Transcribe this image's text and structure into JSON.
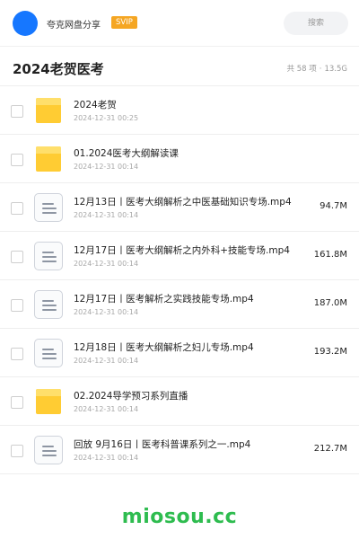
{
  "topbar": {
    "username": "夸克网盘分享",
    "badge": "SVIP",
    "search_placeholder": "搜索"
  },
  "header": {
    "title": "2024老贺医考",
    "item_count": "共 58 项",
    "total_size": "13.5G"
  },
  "files": [
    {
      "type": "folder",
      "name": "2024老贺",
      "date": "2024-12-31 00:25",
      "size": ""
    },
    {
      "type": "folder",
      "name": "01.2024医考大纲解读课",
      "date": "2024-12-31 00:14",
      "size": ""
    },
    {
      "type": "file",
      "name": "12月13日丨医考大纲解析之中医基础知识专场.mp4",
      "date": "2024-12-31 00:14",
      "size": "94.7M"
    },
    {
      "type": "file",
      "name": "12月17日丨医考大纲解析之内外科+技能专场.mp4",
      "date": "2024-12-31 00:14",
      "size": "161.8M"
    },
    {
      "type": "file",
      "name": "12月17日丨医考解析之实践技能专场.mp4",
      "date": "2024-12-31 00:14",
      "size": "187.0M"
    },
    {
      "type": "file",
      "name": "12月18日丨医考大纲解析之妇儿专场.mp4",
      "date": "2024-12-31 00:14",
      "size": "193.2M"
    },
    {
      "type": "folder",
      "name": "02.2024导学预习系列直播",
      "date": "2024-12-31 00:14",
      "size": ""
    },
    {
      "type": "file",
      "name": "回放 9月16日丨医考科普课系列之一.mp4",
      "date": "2024-12-31 00:14",
      "size": "212.7M"
    }
  ],
  "watermark": "miosou.cc",
  "colors": {
    "avatar": "#1677ff",
    "svip_badge": "#f5a623",
    "folder": "#ffcc33",
    "watermark": "#2ebc4f"
  },
  "icons": {
    "folder": "folder-icon",
    "file": "video-file-icon"
  }
}
